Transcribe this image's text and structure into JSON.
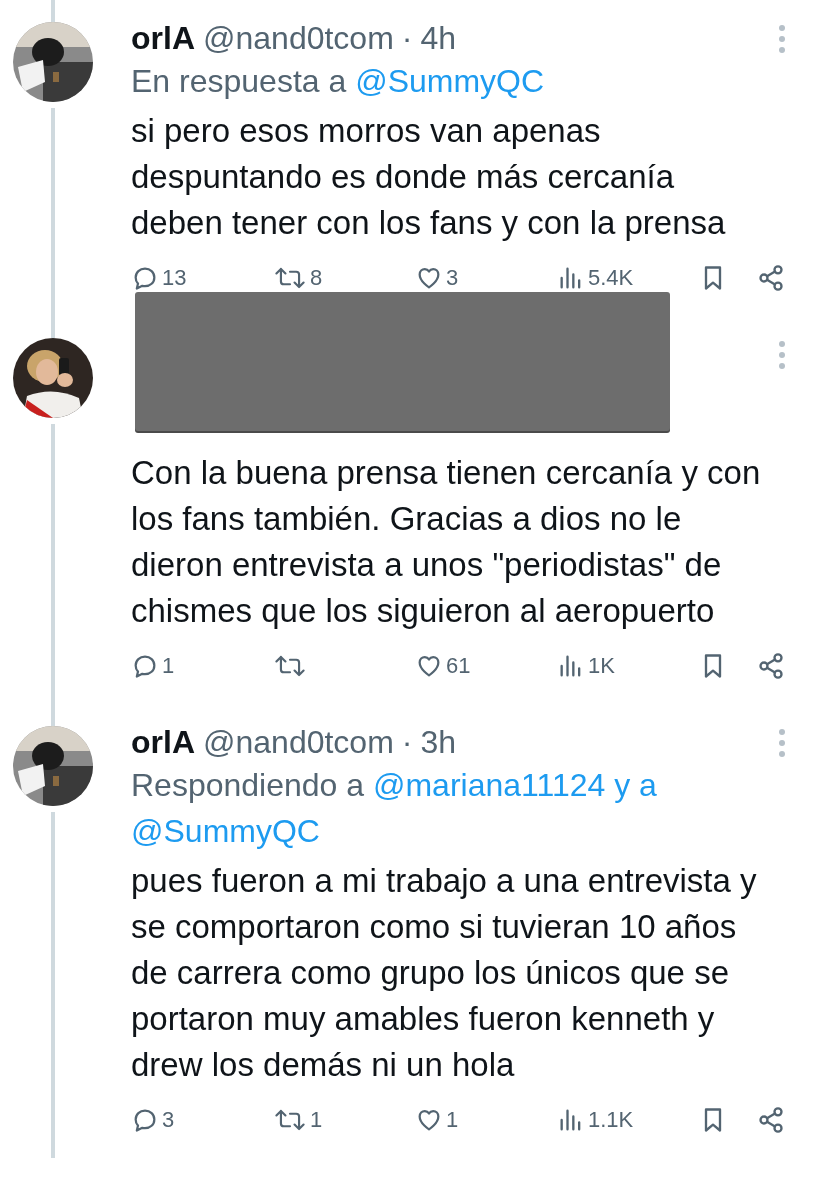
{
  "tweets": [
    {
      "avatar": {
        "kind": "picture"
      },
      "redacted": false,
      "name": "orlA",
      "handle": "@nand0tcom",
      "separator": "·",
      "time": "4h",
      "reply_prefix": "En respuesta a",
      "reply_to": [
        "@SummyQC"
      ],
      "text": "si pero esos morros van apenas\ndespuntando es donde más cercanía\ndeben tener con los fans y con la prensa",
      "actions": {
        "replies": "13",
        "reposts": "8",
        "likes": "3",
        "views": "5.4K"
      }
    },
    {
      "avatar": {
        "kind": "picture"
      },
      "redacted": true,
      "text": "Con la buena prensa tienen cercanía y con\nlos fans también. Gracias a dios no le\ndieron entrevista a unos \"periodistas\" de\nchismes que los siguieron al aeropuerto",
      "actions": {
        "replies": "1",
        "likes": "61",
        "views": "1K"
      }
    },
    {
      "avatar": {
        "kind": "picture"
      },
      "redacted": false,
      "name": "orlA",
      "handle": "@nand0tcom",
      "separator": "·",
      "time": "3h",
      "reply_prefix": "Respondiendo a",
      "reply_to": [
        "@mariana11124 y a",
        "@SummyQC"
      ],
      "text": "pues fueron a mi trabajo a una entrevista y\nse comportaron como si tuvieran 10 años\nde carrera como grupo los únicos que se\nportaron muy amables fueron kenneth y\ndrew los demás ni un hola",
      "actions": {
        "replies": "3",
        "reposts": "1",
        "likes": "1",
        "views": "1.1K"
      }
    }
  ]
}
